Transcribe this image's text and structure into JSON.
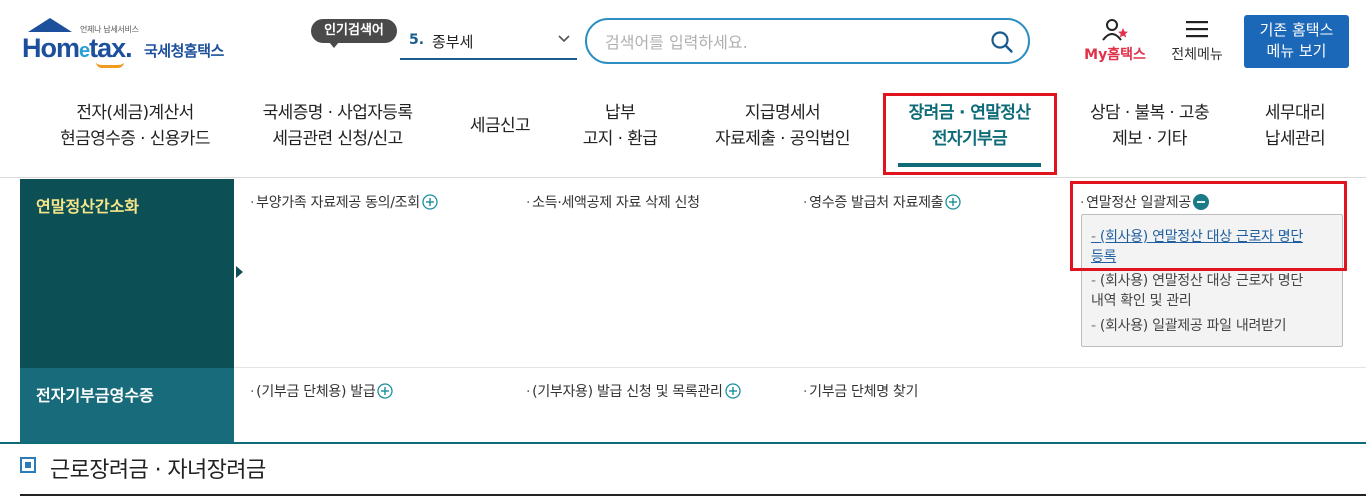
{
  "header": {
    "logo": {
      "sub": "언제나 납세서비스",
      "main_a": "Hom",
      "main_e": "e",
      "main_b": "tax.",
      "korean": "국세청홈택스"
    },
    "popular": {
      "badge": "인기검색어",
      "rank": "5.",
      "term": "종부세"
    },
    "search": {
      "placeholder": "검색어를 입력하세요."
    },
    "my_hometax": "My홈택스",
    "all_menu": "전체메뉴",
    "old_hometax_line1": "기존 홈택스",
    "old_hometax_line2": "메뉴 보기"
  },
  "nav": [
    {
      "line1": "전자(세금)계산서",
      "line2": "현금영수증 · 신용카드"
    },
    {
      "line1": "국세증명 · 사업자등록",
      "line2": "세금관련 신청/신고"
    },
    {
      "line1": "세금신고",
      "line2": ""
    },
    {
      "line1": "납부",
      "line2": "고지 · 환급"
    },
    {
      "line1": "지급명세서",
      "line2": "자료제출 · 공익법인"
    },
    {
      "line1": "장려금 · 연말정산",
      "line2": "전자기부금"
    },
    {
      "line1": "상담 · 불복 · 고충",
      "line2": "제보 · 기타"
    },
    {
      "line1": "세무대리",
      "line2": "납세관리"
    }
  ],
  "mega": {
    "cat1": {
      "title": "연말정산간소화",
      "links": [
        "부양가족 자료제공 동의/조회",
        "소득·세액공제 자료 삭제 신청",
        "영수증 발급처 자료제출",
        "연말정산 일괄제공"
      ],
      "sub_items": [
        "(회사용) 연말정산 대상 근로자 명단",
        "등록",
        "(회사용) 연말정산 대상 근로자 명단",
        "내역 확인 및 관리",
        "(회사용) 일괄제공 파일 내려받기"
      ]
    },
    "cat2": {
      "title": "전자기부금영수증",
      "links": [
        "(기부금 단체용) 발급",
        "(기부자용) 발급 신청 및 목록관리",
        "기부금 단체명 찾기"
      ]
    }
  },
  "page_title": "근로장려금 · 자녀장려금",
  "colors": {
    "brand_blue": "#1c4f9c",
    "teal_dark": "#0c5055",
    "teal": "#176b7a",
    "highlight_red": "#e0141e",
    "my_pink": "#e0314b"
  }
}
